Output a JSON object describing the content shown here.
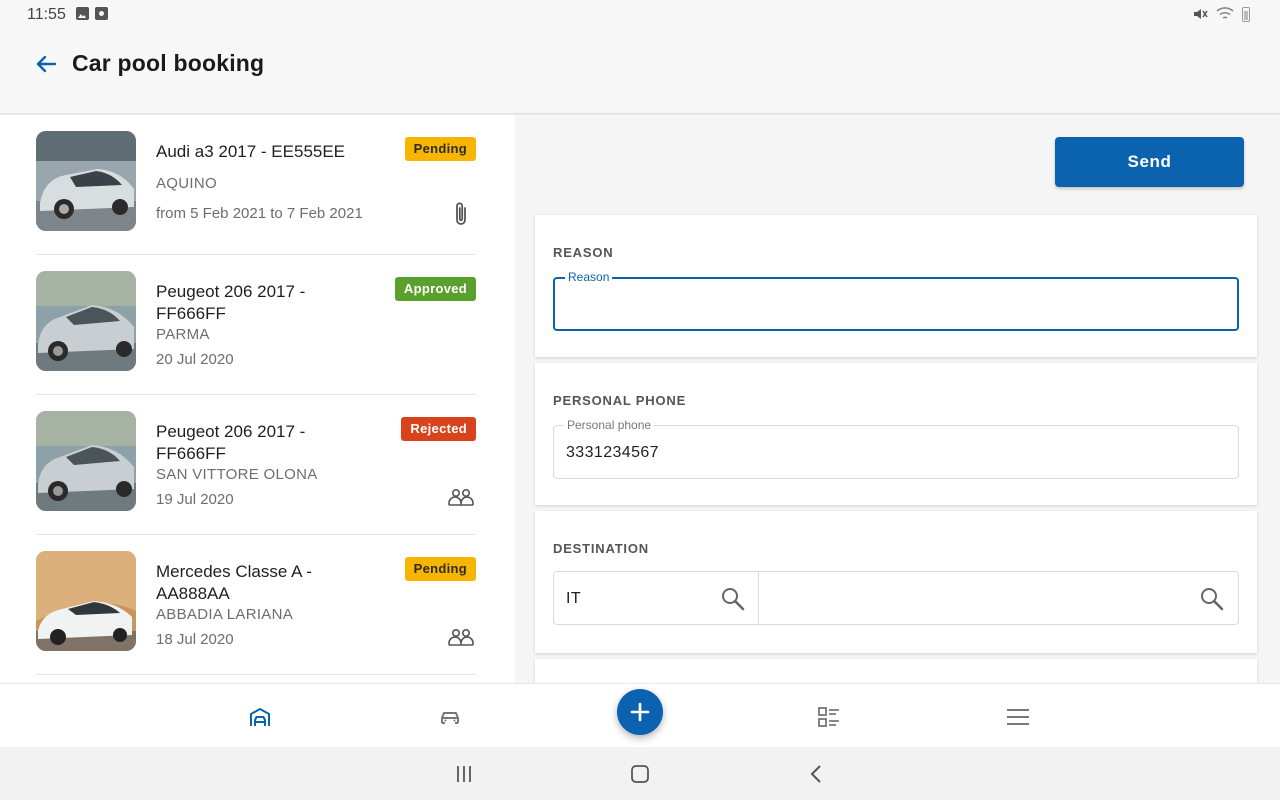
{
  "status_bar": {
    "time": "11:55"
  },
  "header": {
    "title": "Car pool booking"
  },
  "bookings": [
    {
      "title": "Audi a3 2017 - EE555EE",
      "location": "AQUINO",
      "date": "from 5 Feb 2021 to 7 Feb 2021",
      "status": "Pending",
      "status_color": "#f7b500",
      "status_text_color": "#2b2b2b",
      "icon": "paperclip-icon"
    },
    {
      "title": "Peugeot 206 2017 - FF666FF",
      "location": "PARMA",
      "date": "20 Jul 2020",
      "status": "Approved",
      "status_color": "#5aa02c",
      "status_text_color": "#ffffff",
      "icon": ""
    },
    {
      "title": "Peugeot 206 2017 - FF666FF",
      "location": "SAN VITTORE OLONA",
      "date": "19 Jul 2020",
      "status": "Rejected",
      "status_color": "#d9431c",
      "status_text_color": "#ffffff",
      "icon": "people-icon"
    },
    {
      "title": "Mercedes Classe A - AA888AA",
      "location": "ABBADIA LARIANA",
      "date": "18 Jul 2020",
      "status": "Pending",
      "status_color": "#f7b500",
      "status_text_color": "#2b2b2b",
      "icon": "people-icon"
    }
  ],
  "form": {
    "send_label": "Send",
    "reason": {
      "section_label": "REASON",
      "field_label": "Reason",
      "value": ""
    },
    "phone": {
      "section_label": "PERSONAL PHONE",
      "field_label": "Personal phone",
      "value": "3331234567"
    },
    "destination": {
      "section_label": "DESTINATION",
      "country_value": "IT",
      "city_value": ""
    }
  },
  "bottom_nav": [
    "garage-icon",
    "car-icon",
    "add-icon",
    "checklist-icon",
    "menu-icon"
  ],
  "colors": {
    "accent": "#0b63b0",
    "pending": "#f7b500",
    "approved": "#5aa02c",
    "rejected": "#d9431c"
  }
}
